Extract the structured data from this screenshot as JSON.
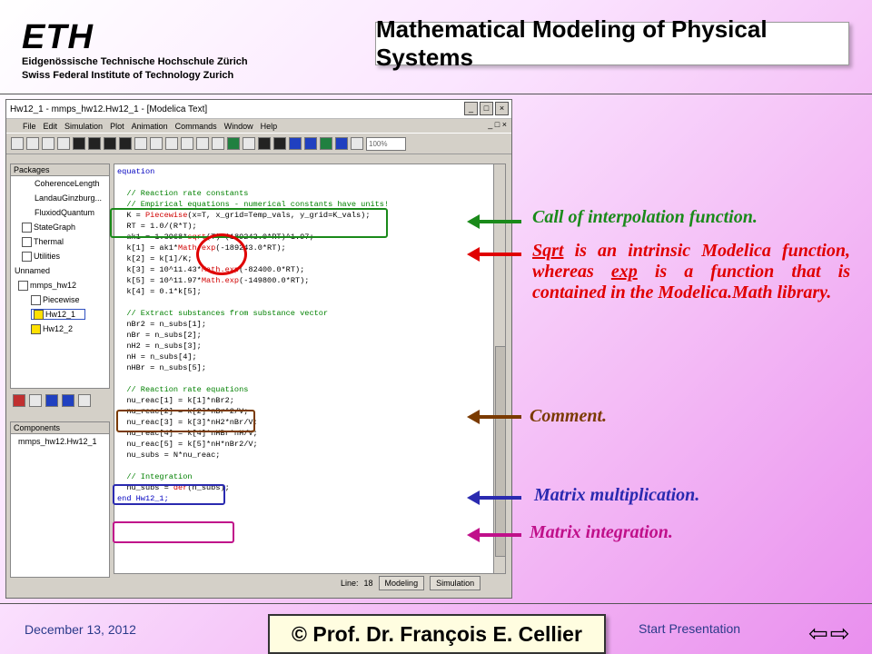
{
  "header": {
    "eth_word": "ETH",
    "eth_line1": "Eidgenössische Technische Hochschule Zürich",
    "eth_line2": "Swiss Federal Institute of Technology Zurich",
    "title": "Mathematical Modeling of Physical Systems"
  },
  "window": {
    "title": "Hw12_1 - mmps_hw12.Hw12_1 - [Modelica Text]",
    "controls": [
      "_",
      "□",
      "×"
    ],
    "menu": [
      "File",
      "Edit",
      "Simulation",
      "Plot",
      "Animation",
      "Commands",
      "Window",
      "Help"
    ],
    "menu_right": "_ □ ×",
    "zoom": "100%",
    "packages_header": "Packages",
    "tree": [
      "CoherenceLength",
      "LandauGinzburg...",
      "FluxiodQuantum",
      "StateGraph",
      "Thermal",
      "Utilities",
      "Unnamed",
      "mmps_hw12",
      "Piecewise",
      "Hw12_1",
      "Hw12_2"
    ],
    "components_header": "Components",
    "components_item": "mmps_hw12.Hw12_1",
    "line_label": "Line:",
    "line_value": "18",
    "modeling_label": "Modeling",
    "simulation_label": "Simulation"
  },
  "code": {
    "l1": "equation",
    "l2": "  // Reaction rate constants",
    "l3": "  // Empirical equations - numerical constants have units!",
    "l4a": "  K = ",
    "l4b": "Piecewise",
    "l4c": "(x=T, x_grid=Temp_vals, y_grid=K_vals);",
    "l5": "  RT = 1.0/(R*T);",
    "l6a": "  ak1 = 1.3968*",
    "l6b": "sqrt",
    "l6c": "(T)*(189243.0*RT)^1.97;",
    "l7a": "  k[1] = ak1*",
    "l7b": "Math.exp",
    "l7c": "(-189243.0*RT);",
    "l8": "  k[2] = k[1]/K;",
    "l9a": "  k[3] = 10^11.43*",
    "l9b": "Math.exp",
    "l9c": "(-82400.0*RT);",
    "l10a": "  k[5] = 10^11.97*",
    "l10b": "Math.exp",
    "l10c": "(-149800.0*RT);",
    "l11": "  k[4] = 0.1*k[5];",
    "l12": "  // Extract substances from substance vector",
    "l13": "  nBr2 = n_subs[1];",
    "l14": "  nBr = n_subs[2];",
    "l15": "  nH2 = n_subs[3];",
    "l16": "  nH = n_subs[4];",
    "l17": "  nHBr = n_subs[5];",
    "l18": "  // Reaction rate equations",
    "l19": "  nu_reac[1] = k[1]*nBr2;",
    "l20": "  nu_reac[2] = k[2]*nBr^2/V;",
    "l21": "  nu_reac[3] = k[3]*nH2*nBr/V;",
    "l22": "  nu_reac[4] = k[4]*nHBr*nH/V;",
    "l23": "  nu_reac[5] = k[5]*nH*nBr2/V;",
    "l24": "  nu_subs = N*nu_reac;",
    "l25": "  // Integration",
    "l26a": "  nu_subs = ",
    "l26b": "der",
    "l26c": "(n_subs);",
    "l27": "end Hw12_1;"
  },
  "annotations": {
    "interp": "Call of interpolation function.",
    "sqrt_word": "Sqrt",
    "sqrt_mid": " is an intrinsic Modelica function, whereas ",
    "exp_word": "exp",
    "sqrt_end": " is a function that is contained in the Modelica.Math library.",
    "comment": "Comment.",
    "matmul": "Matrix multiplication.",
    "matint": "Matrix integration."
  },
  "colors": {
    "green": "#1a8a1a",
    "red": "#e00000",
    "brown": "#7a3a00",
    "blue": "#2a2ab0",
    "magenta": "#c0108a"
  },
  "footer": {
    "date": "December 13, 2012",
    "author": "© Prof. Dr. François E. Cellier",
    "start": "Start Presentation",
    "nav_back": "⇦",
    "nav_fwd": "⇨"
  }
}
